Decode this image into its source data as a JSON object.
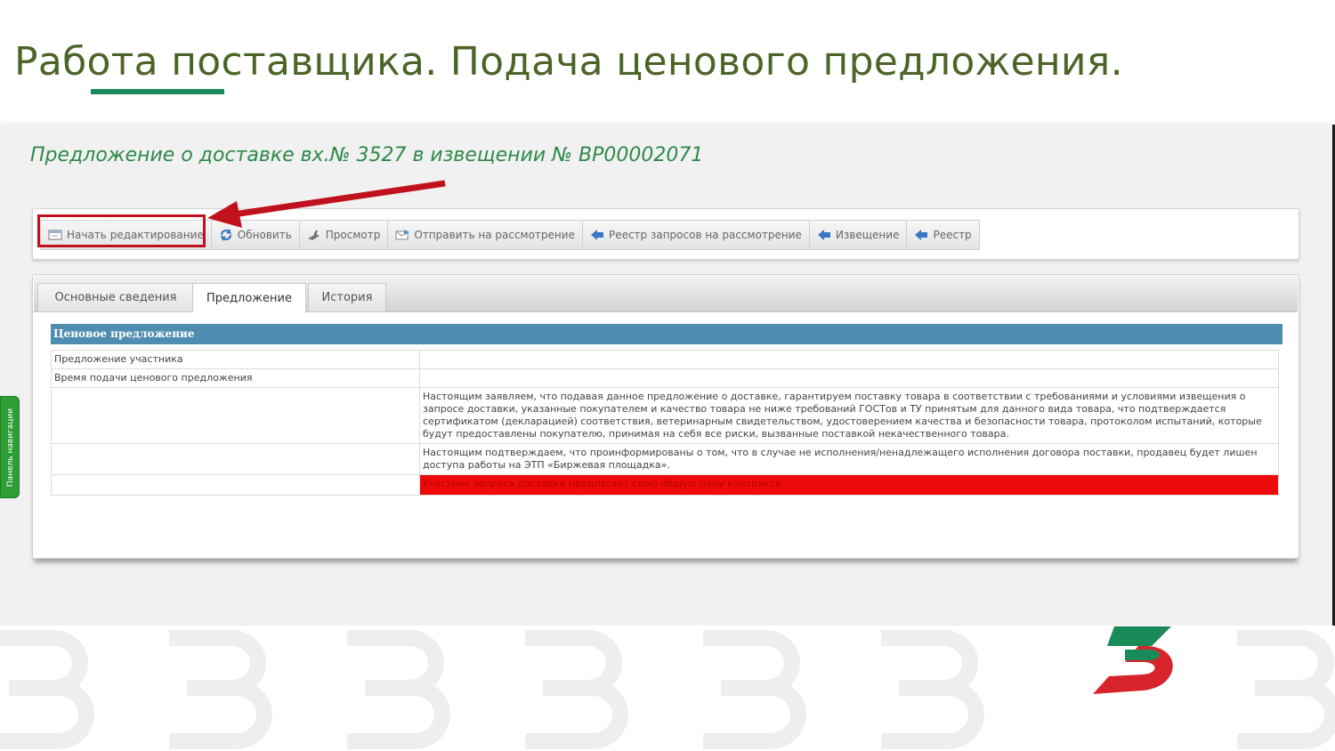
{
  "slide": {
    "title": "Работа поставщика. Подача ценового предложения."
  },
  "screen": {
    "heading": "Предложение о доставке вх.№ 3527 в извещении № ВР00002071",
    "toolbar": {
      "buttons": [
        {
          "label": "Начать редактирование",
          "icon": "edit-window-icon"
        },
        {
          "label": "Обновить",
          "icon": "refresh-icon"
        },
        {
          "label": "Просмотр",
          "icon": "preview-icon"
        },
        {
          "label": "Отправить на рассмотрение",
          "icon": "send-envelope-icon"
        },
        {
          "label": "Реестр запросов на рассмотрение",
          "icon": "back-arrow-icon"
        },
        {
          "label": "Извещение",
          "icon": "back-arrow-icon"
        },
        {
          "label": "Реестр",
          "icon": "back-arrow-icon"
        }
      ]
    },
    "tabs": [
      {
        "label": "Основные сведения",
        "active": false
      },
      {
        "label": "Предложение",
        "active": true
      },
      {
        "label": "История",
        "active": false
      }
    ],
    "section": {
      "title": "Ценовое предложение",
      "rows": [
        {
          "label": "Предложение участника",
          "value": ""
        },
        {
          "label": "Время подачи ценового предложения",
          "value": ""
        },
        {
          "label": "",
          "value": "Настоящим заявляем, что подавая данное предложение о доставке, гарантируем поставку товара в соответствии с требованиями и условиями извещения о запросе доставки, указанные покупателем и качество товара не ниже требований ГОСТов и ТУ принятым для данного вида товара, что подтверждается сертификатом (декларацией) соответствия, ветеринарным свидетельством, удостоверением качества и безопасности товара, протоколом испытаний, которые будут предоставлены покупателю, принимая на себя все риски, вызванные поставкой некачественного товара."
        },
        {
          "label": "",
          "value": "Настоящим подтверждаем, что проинформированы о том, что в случае не исполнения/ненадлежащего исполнения договора поставки, продавец будет лишен доступа работы на ЭТП «Биржевая площадка»."
        },
        {
          "label": "",
          "value": "Участник запроса доставки предлагает свою общую цену контракта"
        }
      ]
    },
    "nav_panel_label": "Панель навигации"
  },
  "colors": {
    "title": "#4d6428",
    "heading": "#2e8a4a",
    "section_header": "#4f8db0",
    "alert": "#ee0a0a",
    "highlight": "#c0121c",
    "logo_green": "#1a8a5a",
    "logo_red": "#d8232a"
  }
}
